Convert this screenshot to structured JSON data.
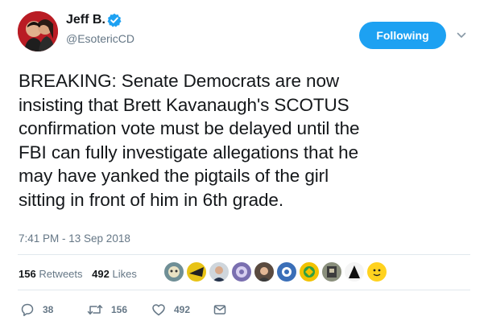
{
  "user": {
    "display_name": "Jeff B.",
    "handle": "@EsotericCD",
    "avatar_icon": "avatar",
    "verified_icon": "verified-badge-icon"
  },
  "follow_button": {
    "label": "Following"
  },
  "tweet": {
    "text": "BREAKING: Senate Democrats are now\ninsisting that Brett Kavanaugh's SCOTUS\nconfirmation vote must be delayed until the\nFBI can fully investigate allegations that he\nmay have yanked the pigtails of the girl\nsitting in front of him in 6th grade.",
    "timestamp": "7:41 PM - 13 Sep 2018"
  },
  "stats": {
    "retweets_count": "156",
    "retweets_label": "Retweets",
    "likes_count": "492",
    "likes_label": "Likes"
  },
  "actions": {
    "reply_count": "38",
    "retweet_count": "156",
    "like_count": "492"
  },
  "colors": {
    "accent": "#1da1f2",
    "text": "#14171a",
    "muted": "#657786",
    "divider": "#e1e8ed"
  }
}
